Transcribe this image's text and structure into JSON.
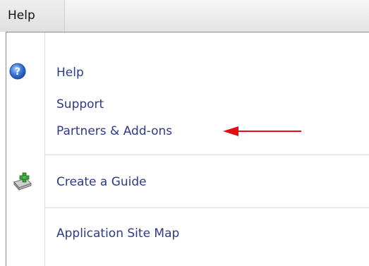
{
  "menubar": {
    "menu_label": "Help"
  },
  "menu": {
    "items": [
      {
        "label": "Help",
        "icon": "help-question-icon"
      },
      {
        "label": "Support"
      },
      {
        "label": "Partners & Add-ons",
        "annotation": "red-arrow"
      },
      {
        "label": "Create a Guide",
        "icon": "create-guide-icon"
      },
      {
        "label": "Application Site Map"
      }
    ]
  },
  "colors": {
    "menu_text": "#2d3a8c",
    "help_icon": "#3a7ad8",
    "annotation_arrow": "#e01010",
    "guide_icon_plus": "#3aa43a"
  }
}
